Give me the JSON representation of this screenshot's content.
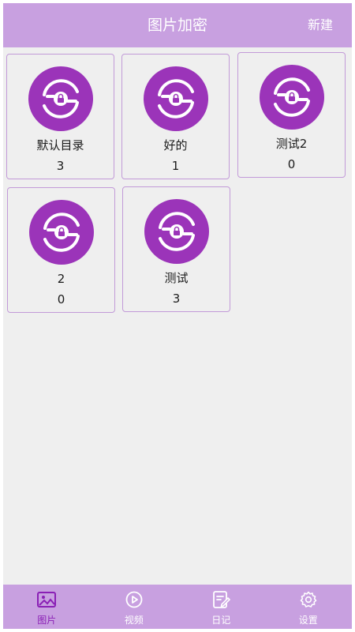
{
  "header": {
    "title": "图片加密",
    "new_label": "新建"
  },
  "folders": [
    {
      "name": "默认目录",
      "count": "3"
    },
    {
      "name": "好的",
      "count": "1"
    },
    {
      "name": "测试2",
      "count": "0"
    },
    {
      "name": "2",
      "count": "0"
    },
    {
      "name": "测试",
      "count": "3"
    }
  ],
  "bottom_nav": [
    {
      "label": "图片",
      "icon": "image-icon",
      "active": true
    },
    {
      "label": "视频",
      "icon": "video-play-icon",
      "active": false
    },
    {
      "label": "日记",
      "icon": "diary-edit-icon",
      "active": false
    },
    {
      "label": "设置",
      "icon": "gear-icon",
      "active": false
    }
  ],
  "colors": {
    "header": "#c8a0e0",
    "logo_bg": "#9b34b9",
    "card_border": "#c29ad8",
    "active_nav": "#8a1fb5",
    "content_bg": "#efefef"
  }
}
